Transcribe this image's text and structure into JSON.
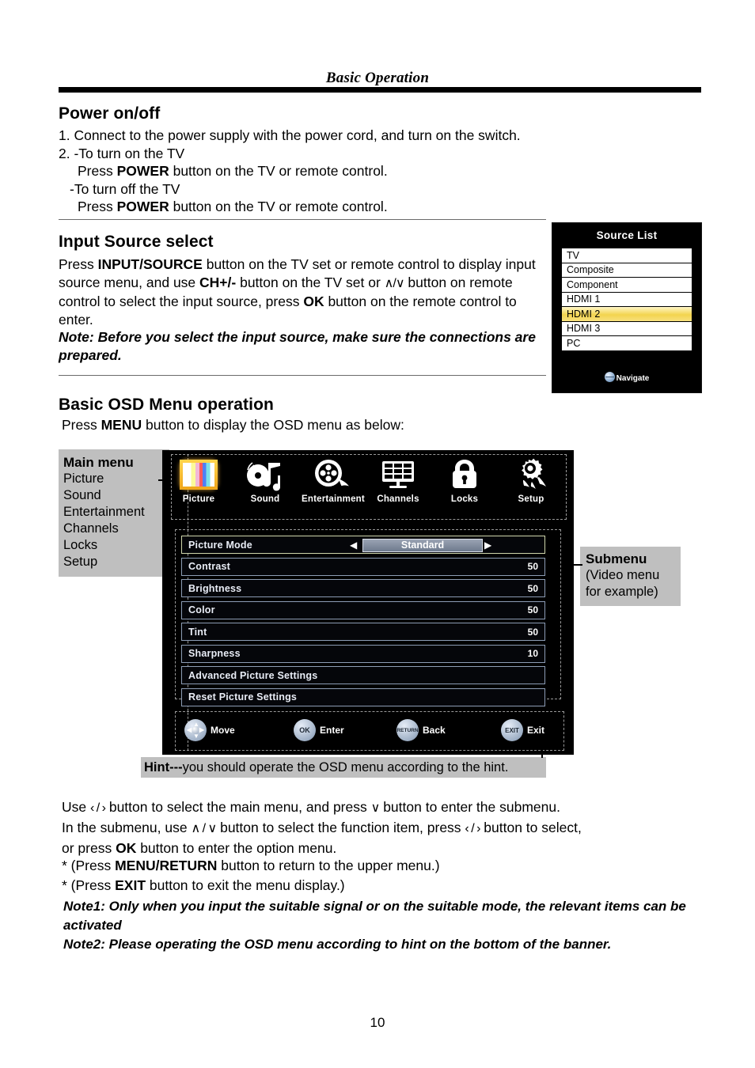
{
  "header": {
    "title": "Basic Operation"
  },
  "power_section": {
    "heading": "Power on/off",
    "line1": "1. Connect to the power supply with the power cord, and turn on the switch.",
    "line2": "2. -To turn on the TV",
    "line3_pre": "Press ",
    "line3_bold": "POWER",
    "line3_post": " button on the TV or remote control.",
    "line4": "-To turn off the TV",
    "line5_pre": "Press ",
    "line5_bold": "POWER",
    "line5_post": " button on the TV or remote control."
  },
  "input_section": {
    "heading": "Input Source select",
    "p1_a": "Press ",
    "p1_b": "INPUT/SOURCE",
    "p1_c": " button on the TV set or remote control to display input source menu, and use ",
    "p1_d": "CH+/-",
    "p1_e": " button on the TV set or ",
    "p1_f": "∧/∨",
    "p1_g": " button on remote control to select the input source, press ",
    "p1_h": "OK",
    "p1_i": " button on the remote control to enter.",
    "note": "Note: Before you select the input source, make sure the connections are prepared."
  },
  "source_list": {
    "title": "Source List",
    "items": [
      {
        "label": "TV",
        "selected": false
      },
      {
        "label": "Composite",
        "selected": false
      },
      {
        "label": "Component",
        "selected": false
      },
      {
        "label": "HDMI 1",
        "selected": false
      },
      {
        "label": "HDMI 2",
        "selected": true
      },
      {
        "label": "HDMI 3",
        "selected": false
      },
      {
        "label": "PC",
        "selected": false
      }
    ],
    "footer_label": "Navigate",
    "footer_icon": "navigate-globe-icon",
    "highlight_color": "#f3d44e"
  },
  "osd_section": {
    "heading": "Basic OSD Menu operation",
    "intro_a": "Press ",
    "intro_b": "MENU",
    "intro_c": " button to display the OSD menu as below:"
  },
  "annotations": {
    "main_menu_title": "Main menu",
    "main_menu_items": [
      "Picture",
      "Sound",
      "Entertainment",
      "Channels",
      "Locks",
      "Setup"
    ],
    "submenu_title": "Submenu",
    "submenu_line1": "(Video menu",
    "submenu_line2": "for example)",
    "hint_bold": "Hint---",
    "hint_text": "you should operate the OSD menu according to the hint."
  },
  "osd": {
    "main_icons": [
      {
        "label": "Picture",
        "icon": "picture-colorbars-icon",
        "selected": true
      },
      {
        "label": "Sound",
        "icon": "sound-disc-note-icon",
        "selected": false
      },
      {
        "label": "Entertainment",
        "icon": "film-reel-icon",
        "selected": false
      },
      {
        "label": "Channels",
        "icon": "tv-grid-icon",
        "selected": false
      },
      {
        "label": "Locks",
        "icon": "padlock-icon",
        "selected": false
      },
      {
        "label": "Setup",
        "icon": "gear-wrench-icon",
        "selected": false
      }
    ],
    "submenu_rows": [
      {
        "label": "Picture Mode",
        "value": "Standard",
        "type": "option"
      },
      {
        "label": "Contrast",
        "value": "50",
        "type": "number"
      },
      {
        "label": "Brightness",
        "value": "50",
        "type": "number"
      },
      {
        "label": "Color",
        "value": "50",
        "type": "number"
      },
      {
        "label": "Tint",
        "value": "50",
        "type": "number"
      },
      {
        "label": "Sharpness",
        "value": "10",
        "type": "number"
      },
      {
        "label": "Advanced Picture Settings",
        "value": "",
        "type": "link"
      },
      {
        "label": "Reset Picture Settings",
        "value": "",
        "type": "link"
      }
    ],
    "hint_keys": [
      {
        "key": "",
        "icon": "dpad-icon",
        "label": "Move"
      },
      {
        "key": "OK",
        "icon": "ok-key-icon",
        "label": "Enter"
      },
      {
        "key": "RETURN",
        "icon": "return-key-icon",
        "label": "Back"
      },
      {
        "key": "EXIT",
        "icon": "exit-key-icon",
        "label": "Exit"
      }
    ]
  },
  "usage": {
    "line1_a": "Use ",
    "line1_b": "‹ / ›",
    "line1_c": " button to select the main menu, and press ",
    "line1_d": "∨",
    "line1_e": " button to enter the submenu.",
    "line2_a": "In the submenu, use ",
    "line2_b": "∧ / ∨",
    "line2_c": " button to select the function item, press ",
    "line2_d": "‹ / ›",
    "line2_e": " button to select,",
    "line3_a": "or press ",
    "line3_b": "OK",
    "line3_c": " button to enter the option menu.",
    "star1_a": "* (Press ",
    "star1_b": "MENU/RETURN",
    "star1_c": " button to return to the upper menu.)",
    "star2_a": "* (Press ",
    "star2_b": "EXIT",
    "star2_c": " button to exit the menu display.)"
  },
  "notes": {
    "note1": "Note1: Only when you input the suitable signal or on the suitable mode, the relevant items can be activated",
    "note2": "Note2: Please operating the OSD menu according to hint on the bottom of the banner."
  },
  "page_number": "10"
}
